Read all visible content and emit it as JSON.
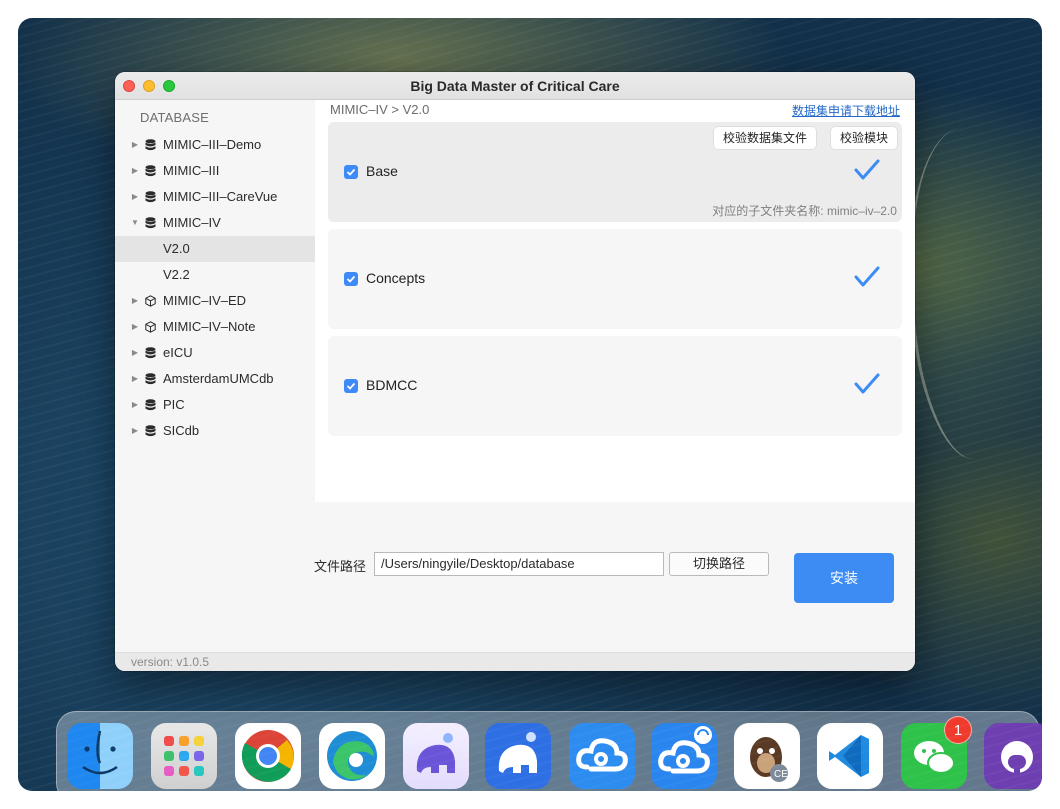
{
  "window": {
    "title": "Big Data Master of Critical Care"
  },
  "sidebar": {
    "header": "DATABASE",
    "items": [
      {
        "label": "MIMIC–III–Demo",
        "caret": "▶",
        "icon": "database-icon"
      },
      {
        "label": "MIMIC–III",
        "caret": "▶",
        "icon": "database-icon"
      },
      {
        "label": "MIMIC–III–CareVue",
        "caret": "▶",
        "icon": "database-icon"
      },
      {
        "label": "MIMIC–IV",
        "caret": "▼",
        "icon": "database-icon"
      },
      {
        "label": "V2.0",
        "selected": true
      },
      {
        "label": "V2.2"
      },
      {
        "label": "MIMIC–IV–ED",
        "caret": "▶",
        "icon": "cube-icon"
      },
      {
        "label": "MIMIC–IV–Note",
        "caret": "▶",
        "icon": "cube-icon"
      },
      {
        "label": "eICU",
        "caret": "▶",
        "icon": "database-icon"
      },
      {
        "label": "AmsterdamUMCdb",
        "caret": "▶",
        "icon": "database-icon"
      },
      {
        "label": "PIC",
        "caret": "▶",
        "icon": "database-icon"
      },
      {
        "label": "SICdb",
        "caret": "▶",
        "icon": "database-icon"
      }
    ]
  },
  "main": {
    "breadcrumb": "MIMIC–IV > V2.0",
    "download_link": "数据集申请下载地址",
    "modules": [
      {
        "label": "Base",
        "checked": true,
        "verified": true,
        "verify_files_button": "校验数据集文件",
        "verify_module_button": "校验模块",
        "subfolder_note": "对应的子文件夹名称: mimic–iv–2.0"
      },
      {
        "label": "Concepts",
        "checked": true,
        "verified": true
      },
      {
        "label": "BDMCC",
        "checked": true,
        "verified": true
      }
    ]
  },
  "footer": {
    "path_label": "文件路径",
    "path_value": "/Users/ningyile/Desktop/database",
    "switch_path_button": "切换路径",
    "install_button": "安装",
    "version": "version: v1.0.5"
  },
  "dock": {
    "apps": [
      {
        "name": "finder-icon",
        "running": true
      },
      {
        "name": "launchpad-icon",
        "running": false
      },
      {
        "name": "chrome-icon",
        "running": true
      },
      {
        "name": "edge-icon",
        "running": false
      },
      {
        "name": "tableplus-elephant-icon",
        "running": false
      },
      {
        "name": "postgres-elephant-icon",
        "running": true
      },
      {
        "name": "cloud-icon",
        "running": false
      },
      {
        "name": "cloud-sync-icon",
        "running": false
      },
      {
        "name": "dbeaver-icon",
        "running": false
      },
      {
        "name": "vscode-icon",
        "running": true
      },
      {
        "name": "wechat-icon",
        "running": true,
        "badge": "1"
      },
      {
        "name": "github-desktop-icon",
        "running": true
      }
    ]
  }
}
